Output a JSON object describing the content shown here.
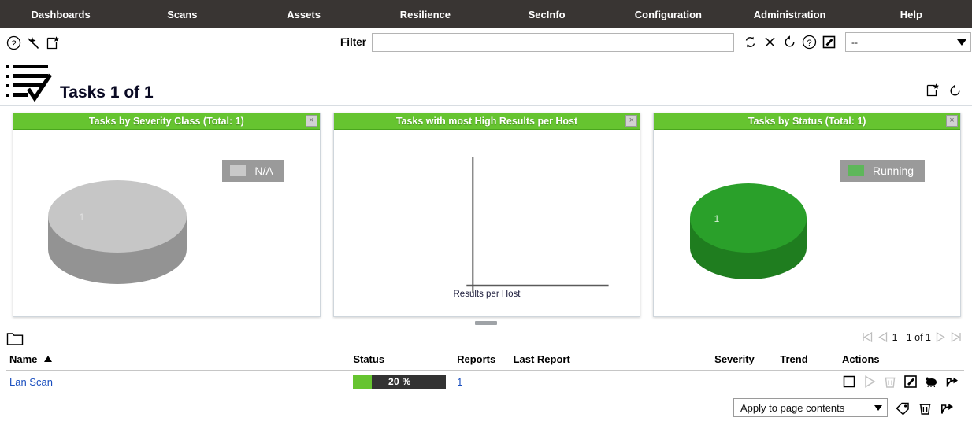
{
  "nav": {
    "items": [
      {
        "label": "Dashboards",
        "name": "nav-dashboards"
      },
      {
        "label": "Scans",
        "name": "nav-scans"
      },
      {
        "label": "Assets",
        "name": "nav-assets"
      },
      {
        "label": "Resilience",
        "name": "nav-resilience"
      },
      {
        "label": "SecInfo",
        "name": "nav-secinfo"
      },
      {
        "label": "Configuration",
        "name": "nav-configuration"
      },
      {
        "label": "Administration",
        "name": "nav-administration"
      },
      {
        "label": "Help",
        "name": "nav-help"
      }
    ]
  },
  "toolbar": {
    "help_icon": "help-icon",
    "wizard_icon": "wizard-wand-icon",
    "new_task_icon": "new-task-icon"
  },
  "filter": {
    "label": "Filter",
    "value": "",
    "placeholder": "",
    "refresh_icon": "refresh-icon",
    "reset_icon": "clear-icon",
    "undo_icon": "reset-filter-icon",
    "help_icon": "filter-help-icon",
    "edit_icon": "edit-filter-icon",
    "select_value": "--"
  },
  "header": {
    "title": "Tasks 1 of 1",
    "list_icon": "tasks-checklist-icon",
    "new_dashboard_icon": "add-dashboard-icon",
    "refresh_icon": "refresh-dashboard-icon"
  },
  "dashboard": {
    "panels": [
      {
        "title": "Tasks by Severity Class (Total: 1)",
        "name": "panel-tasks-by-severity-class",
        "close_label": "×",
        "kind": "pie",
        "legend": [
          {
            "label": "N/A",
            "color": "#c9c9c9"
          }
        ],
        "slice_label": "1",
        "top_color": "#c6c6c6",
        "side_color": "#939393",
        "label_color": "#e0e0e0"
      },
      {
        "title": "Tasks with most High Results per Host",
        "name": "panel-tasks-most-high-results",
        "close_label": "×",
        "kind": "axes",
        "axis_label": "Results per Host"
      },
      {
        "title": "Tasks by Status (Total: 1)",
        "name": "panel-tasks-by-status",
        "close_label": "×",
        "kind": "pie",
        "legend": [
          {
            "label": "Running",
            "color": "#5eb75a"
          }
        ],
        "slice_label": "1",
        "top_color": "#2aa02a",
        "side_color": "#1f7d1f",
        "label_color": "#d8f0d8"
      }
    ]
  },
  "chart_data": [
    {
      "type": "pie",
      "title": "Tasks by Severity Class (Total: 1)",
      "categories": [
        "N/A"
      ],
      "values": [
        1
      ],
      "colors": [
        "#c6c6c6"
      ],
      "data_labels": [
        "1"
      ],
      "legend_position": "top-right",
      "total": 1
    },
    {
      "type": "bar",
      "title": "Tasks with most High Results per Host",
      "categories": [],
      "values": [],
      "xlabel": "Results per Host",
      "ylabel": "",
      "grid": false,
      "legend_position": "none",
      "note": "empty chart, axes only"
    },
    {
      "type": "pie",
      "title": "Tasks by Status (Total: 1)",
      "categories": [
        "Running"
      ],
      "values": [
        1
      ],
      "colors": [
        "#2aa02a"
      ],
      "data_labels": [
        "1"
      ],
      "legend_position": "top-right",
      "total": 1
    }
  ],
  "list": {
    "folder_icon": "folder-icon",
    "pager": {
      "first_icon": "first-page-icon",
      "prev_icon": "previous-page-icon",
      "text": "1 - 1 of 1",
      "next_icon": "next-page-icon",
      "last_icon": "last-page-icon"
    },
    "columns": [
      {
        "label": "Name",
        "name": "column-name",
        "sorted": "asc"
      },
      {
        "label": "Status",
        "name": "column-status"
      },
      {
        "label": "Reports",
        "name": "column-reports"
      },
      {
        "label": "Last Report",
        "name": "column-last-report"
      },
      {
        "label": "Severity",
        "name": "column-severity"
      },
      {
        "label": "Trend",
        "name": "column-trend"
      },
      {
        "label": "Actions",
        "name": "column-actions"
      }
    ],
    "rows": [
      {
        "name": "Lan Scan",
        "status_percent": 20,
        "status_text": "20 %",
        "reports": "1",
        "last_report": "",
        "severity": "",
        "trend": "",
        "actions": [
          "stop-icon",
          "start-icon",
          "delete-icon",
          "edit-icon",
          "clone-icon",
          "export-icon"
        ]
      }
    ]
  },
  "bulk": {
    "select_value": "Apply to page contents",
    "tag_icon": "tag-icon",
    "delete_icon": "trash-icon",
    "export_icon": "export-icon"
  },
  "colors": {
    "nav_background": "#393533",
    "panel_header_green": "#66c430",
    "progress_green": "#66c430",
    "progress_track": "#333333",
    "link_blue": "#1a4fbf"
  }
}
